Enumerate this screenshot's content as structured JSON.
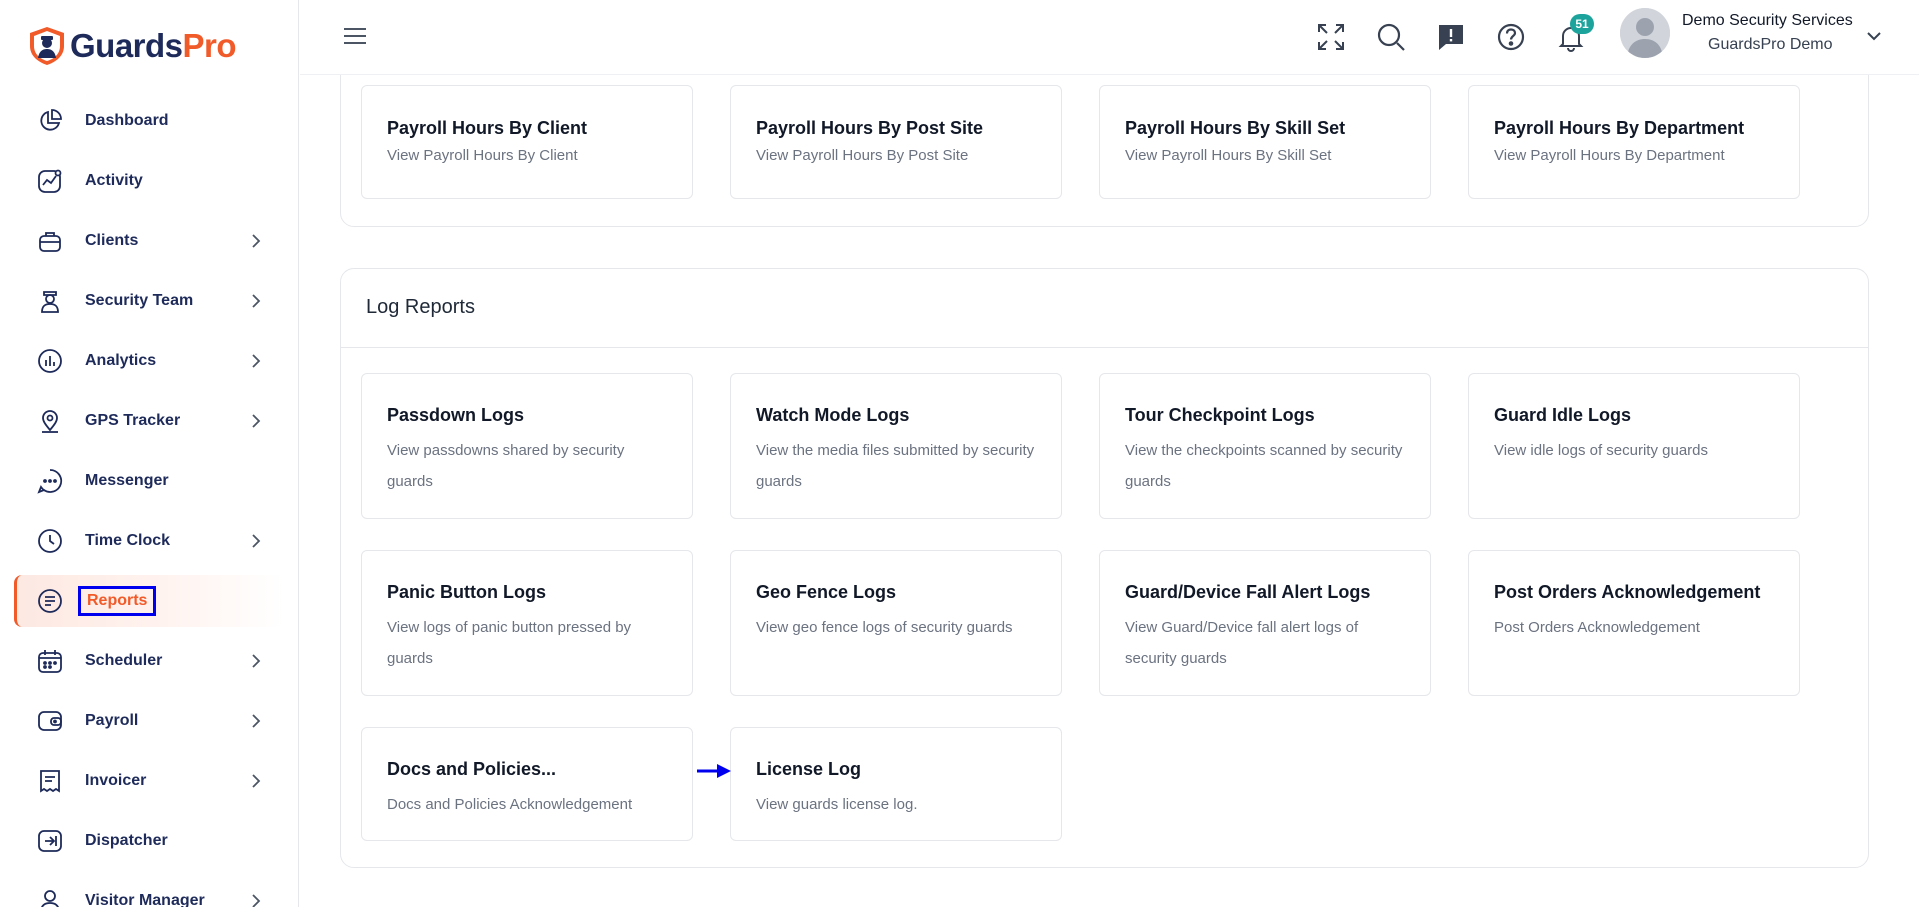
{
  "brand": {
    "part1": "Guards",
    "part2": "Pro"
  },
  "sidebar": {
    "items": [
      {
        "label": "Dashboard",
        "icon": "dashboard-icon",
        "chevron": false
      },
      {
        "label": "Activity",
        "icon": "activity-icon",
        "chevron": false
      },
      {
        "label": "Clients",
        "icon": "briefcase-icon",
        "chevron": true
      },
      {
        "label": "Security Team",
        "icon": "guard-icon",
        "chevron": true
      },
      {
        "label": "Analytics",
        "icon": "analytics-icon",
        "chevron": true
      },
      {
        "label": "GPS Tracker",
        "icon": "location-pin-icon",
        "chevron": true
      },
      {
        "label": "Messenger",
        "icon": "chat-icon",
        "chevron": false
      },
      {
        "label": "Time Clock",
        "icon": "clock-icon",
        "chevron": true
      },
      {
        "label": "Reports",
        "icon": "report-icon",
        "chevron": false,
        "active": true
      },
      {
        "label": "Scheduler",
        "icon": "calendar-icon",
        "chevron": true
      },
      {
        "label": "Payroll",
        "icon": "wallet-icon",
        "chevron": true
      },
      {
        "label": "Invoicer",
        "icon": "invoice-icon",
        "chevron": true
      },
      {
        "label": "Dispatcher",
        "icon": "dispatch-icon",
        "chevron": false
      },
      {
        "label": "Visitor Manager",
        "icon": "visitor-icon",
        "chevron": true
      }
    ]
  },
  "header": {
    "notification_count": "51",
    "user_name": "Demo Security Services",
    "user_org": "GuardsPro Demo"
  },
  "payroll_cards": [
    {
      "title": "Payroll Hours By Client",
      "desc": "View Payroll Hours By Client"
    },
    {
      "title": "Payroll Hours By Post Site",
      "desc": "View Payroll Hours By Post Site"
    },
    {
      "title": "Payroll Hours By Skill Set",
      "desc": "View Payroll Hours By Skill Set"
    },
    {
      "title": "Payroll Hours By Department",
      "desc": "View Payroll Hours By Department"
    }
  ],
  "log_reports": {
    "title": "Log Reports",
    "cards": [
      {
        "title": "Passdown Logs",
        "desc": "View passdowns shared by security guards"
      },
      {
        "title": "Watch Mode Logs",
        "desc": "View the media files submitted by security guards"
      },
      {
        "title": "Tour Checkpoint Logs",
        "desc": "View the checkpoints scanned by security guards"
      },
      {
        "title": "Guard Idle Logs",
        "desc": "View idle logs of security guards"
      },
      {
        "title": "Panic Button Logs",
        "desc": "View logs of panic button pressed by guards"
      },
      {
        "title": "Geo Fence Logs",
        "desc": "View geo fence logs of security guards"
      },
      {
        "title": "Guard/Device Fall Alert Logs",
        "desc": "View Guard/Device fall alert logs of security guards"
      },
      {
        "title": "Post Orders Acknowledgement",
        "desc": "Post Orders Acknowledgement"
      },
      {
        "title": "Docs and Policies...",
        "desc": "Docs and Policies Acknowledgement"
      },
      {
        "title": "License Log",
        "desc": "View guards license log."
      }
    ]
  },
  "colors": {
    "accent": "#f15a29",
    "navy": "#1e2b5a",
    "badge": "#1ba39c",
    "highlight": "#0000ee"
  }
}
